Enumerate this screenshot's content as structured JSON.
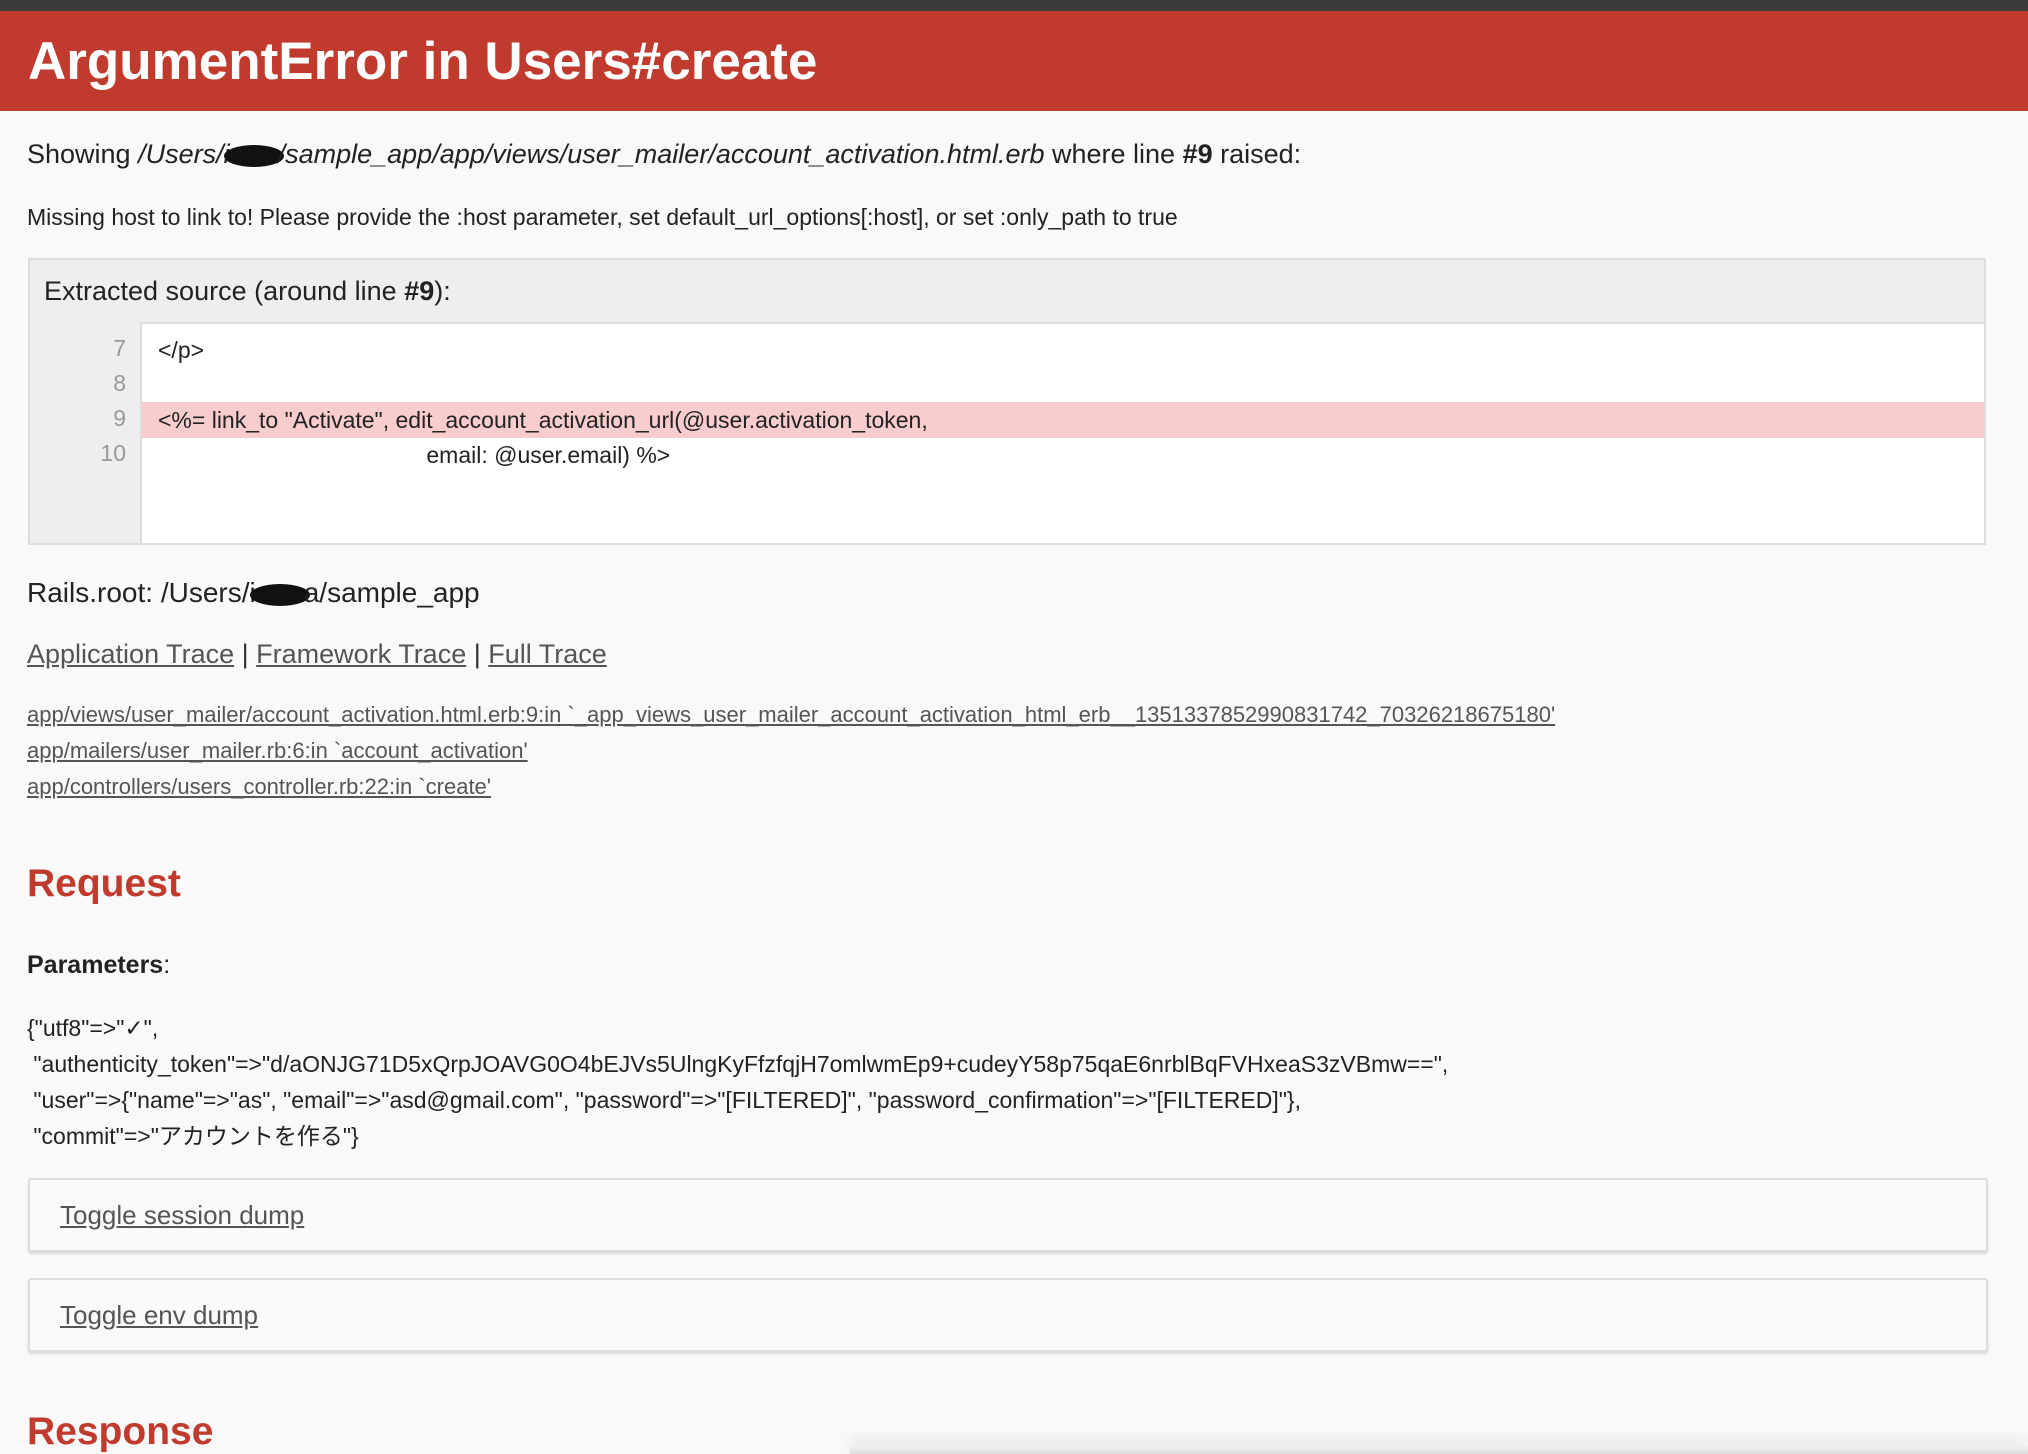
{
  "header": {
    "title": "ArgumentError in Users#create"
  },
  "showing": {
    "prefix": "Showing ",
    "path_start": "/Users/i",
    "path_end": "/sample_app/app/views/user_mailer/account_activation.html.erb",
    "middle": " where line ",
    "line": "#9",
    "suffix": " raised:"
  },
  "message": "Missing host to link to! Please provide the :host parameter, set default_url_options[:host], or set :only_path to true",
  "source": {
    "title_prefix": "Extracted source (around line ",
    "title_line": "#9",
    "title_suffix": "):",
    "lines": [
      {
        "no": "7",
        "code": "</p>"
      },
      {
        "no": "8",
        "code": ""
      },
      {
        "no": "9",
        "code": "<%= link_to \"Activate\", edit_account_activation_url(@user.activation_token,"
      },
      {
        "no": "10",
        "code": "                                          email: @user.email) %>"
      }
    ],
    "highlight_line": "9"
  },
  "rails_root": {
    "prefix": "Rails.root: /Users/i",
    "suffix": "a/sample_app"
  },
  "trace": {
    "application": "Application Trace",
    "framework": "Framework Trace",
    "full": "Full Trace",
    "separator": "|",
    "lines": [
      "app/views/user_mailer/account_activation.html.erb:9:in `_app_views_user_mailer_account_activation_html_erb__1351337852990831742_70326218675180'",
      "app/mailers/user_mailer.rb:6:in `account_activation'",
      "app/controllers/users_controller.rb:22:in `create'"
    ]
  },
  "request": {
    "heading": "Request",
    "params_label": "Parameters",
    "params_colon": ":",
    "params_text": "{\"utf8\"=>\"✓\",\n \"authenticity_token\"=>\"d/aONJG71D5xQrpJOAVG0O4bEJVs5UlngKyFfzfqjH7omlwmEp9+cudeyY58p75qaE6nrblBqFVHxeaS3zVBmw==\",\n \"user\"=>{\"name\"=>\"as\", \"email\"=>\"asd@gmail.com\", \"password\"=>\"[FILTERED]\", \"password_confirmation\"=>\"[FILTERED]\"},\n \"commit\"=>\"アカウントを作る\"}"
  },
  "toggles": {
    "session": "Toggle session dump",
    "env": "Toggle env dump"
  },
  "response": {
    "heading": "Response"
  },
  "colors": {
    "accent": "#c03a2e",
    "highlight": "#f9cdcd"
  }
}
